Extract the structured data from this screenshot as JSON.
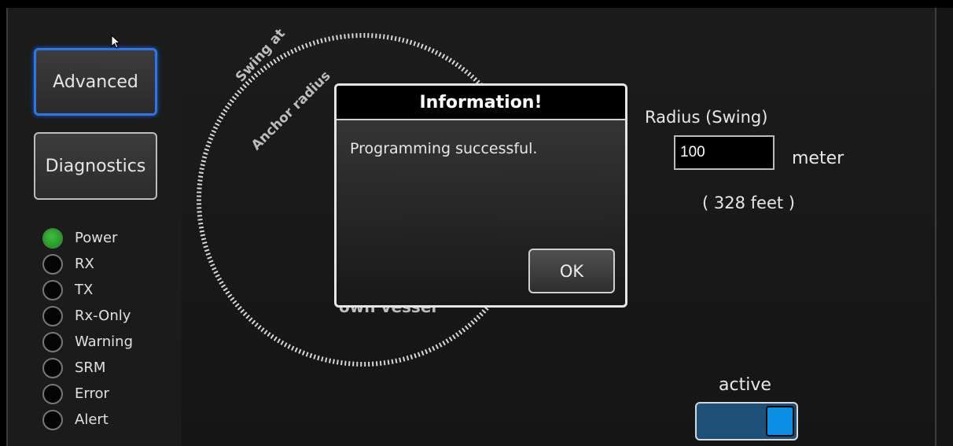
{
  "sidebar": {
    "buttons": [
      {
        "label": "Advanced"
      },
      {
        "label": "Diagnostics"
      }
    ],
    "indicators": [
      {
        "label": "Power",
        "on": true
      },
      {
        "label": "RX",
        "on": false
      },
      {
        "label": "TX",
        "on": false
      },
      {
        "label": "Rx-Only",
        "on": false
      },
      {
        "label": "Warning",
        "on": false
      },
      {
        "label": "SRM",
        "on": false
      },
      {
        "label": "Error",
        "on": false
      },
      {
        "label": "Alert",
        "on": false
      }
    ]
  },
  "diagram": {
    "arc_label_line1": "Swing at",
    "arc_label_line2": "Anchor radius",
    "center_label": "own vessel"
  },
  "dialog": {
    "title": "Information!",
    "message": "Programming successful.",
    "ok_label": "OK"
  },
  "radius": {
    "label": "Radius (Swing)",
    "value": "100",
    "unit": "meter",
    "feet": "( 328 feet )"
  },
  "toggle": {
    "label": "active",
    "state": "on"
  },
  "colors": {
    "accent": "#2f74e8",
    "led_on": "#2aa52a",
    "toggle_knob": "#0c8ee3"
  }
}
